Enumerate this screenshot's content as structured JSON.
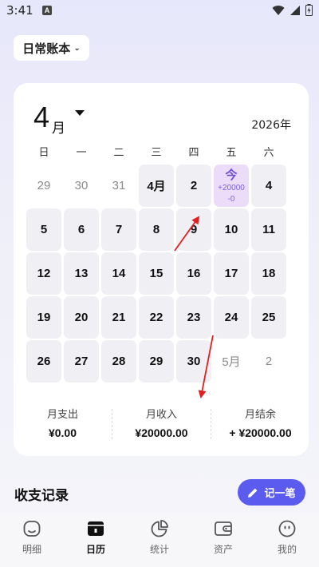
{
  "status_bar": {
    "time": "3:41",
    "notification_letter": "A",
    "icons": [
      "wifi-icon",
      "signal-icon",
      "battery-icon"
    ]
  },
  "book_selector": {
    "label": "日常账本",
    "icon": "chevron-down-icon"
  },
  "calendar": {
    "month": "4",
    "month_unit": "月",
    "year": "2026年",
    "weekdays": [
      "日",
      "一",
      "二",
      "三",
      "四",
      "五",
      "六"
    ],
    "rows": [
      [
        {
          "label": "29",
          "state": "muted"
        },
        {
          "label": "30",
          "state": "muted"
        },
        {
          "label": "31",
          "state": "muted"
        },
        {
          "label": "4月",
          "state": "filled"
        },
        {
          "label": "2",
          "state": "filled"
        },
        {
          "label": "今",
          "sub": "+20000\n-0",
          "state": "today"
        },
        {
          "label": "4",
          "state": "filled"
        }
      ],
      [
        {
          "label": "5",
          "state": "filled"
        },
        {
          "label": "6",
          "state": "filled"
        },
        {
          "label": "7",
          "state": "filled"
        },
        {
          "label": "8",
          "state": "filled"
        },
        {
          "label": "9",
          "state": "filled"
        },
        {
          "label": "10",
          "state": "filled"
        },
        {
          "label": "11",
          "state": "filled"
        }
      ],
      [
        {
          "label": "12",
          "state": "filled"
        },
        {
          "label": "13",
          "state": "filled"
        },
        {
          "label": "14",
          "state": "filled"
        },
        {
          "label": "15",
          "state": "filled"
        },
        {
          "label": "16",
          "state": "filled"
        },
        {
          "label": "17",
          "state": "filled"
        },
        {
          "label": "18",
          "state": "filled"
        }
      ],
      [
        {
          "label": "19",
          "state": "filled"
        },
        {
          "label": "20",
          "state": "filled"
        },
        {
          "label": "21",
          "state": "filled"
        },
        {
          "label": "22",
          "state": "filled"
        },
        {
          "label": "23",
          "state": "filled"
        },
        {
          "label": "24",
          "state": "filled"
        },
        {
          "label": "25",
          "state": "filled"
        }
      ],
      [
        {
          "label": "26",
          "state": "filled"
        },
        {
          "label": "27",
          "state": "filled"
        },
        {
          "label": "28",
          "state": "filled"
        },
        {
          "label": "29",
          "state": "filled"
        },
        {
          "label": "30",
          "state": "filled"
        },
        {
          "label": "5月",
          "state": "muted"
        },
        {
          "label": "2",
          "state": "muted"
        }
      ]
    ]
  },
  "summary": {
    "expense": {
      "label": "月支出",
      "value": "¥0.00"
    },
    "income": {
      "label": "月收入",
      "value": "¥20000.00"
    },
    "balance": {
      "label": "月结余",
      "value": "+ ¥20000.00"
    }
  },
  "records": {
    "title": "收支记录",
    "add_label": "记一笔",
    "add_icon": "pencil-icon"
  },
  "bottom_nav": [
    {
      "label": "明细",
      "icon": "smile-face-icon",
      "active": false
    },
    {
      "label": "日历",
      "icon": "calendar-icon",
      "active": true
    },
    {
      "label": "统计",
      "icon": "pie-chart-icon",
      "active": false
    },
    {
      "label": "资产",
      "icon": "wallet-icon",
      "active": false
    },
    {
      "label": "我的",
      "icon": "profile-face-icon",
      "active": false
    }
  ],
  "colors": {
    "accent": "#5b5bf0",
    "today_bg": "#ecdcf9",
    "today_text": "#6a4ddb",
    "cell_bg": "#efeff4",
    "annotation_arrow": "#e02020"
  }
}
